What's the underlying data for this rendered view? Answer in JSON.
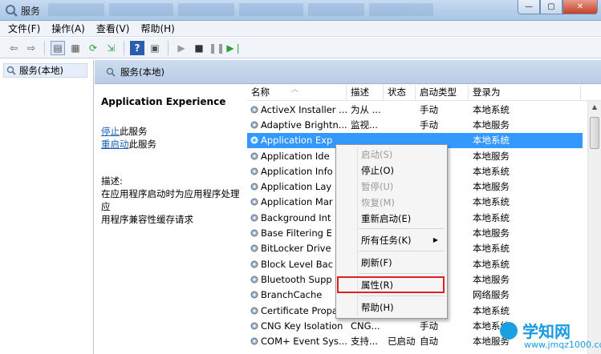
{
  "window": {
    "title": "服务",
    "buttons": {
      "minimize": "—",
      "maximize": "▢",
      "close": "✕"
    }
  },
  "menu": [
    "文件(F)",
    "操作(A)",
    "查看(V)",
    "帮助(H)"
  ],
  "tree": {
    "root": "服务(本地)"
  },
  "main": {
    "header": "服务(本地)",
    "detail": {
      "service_name": "Application Experience",
      "stop_link": "停止",
      "stop_rest": "此服务",
      "restart_link": "重启动",
      "restart_rest": "此服务",
      "desc_label": "描述:",
      "desc_line1": "在应用程序启动时为应用程序处理应",
      "desc_line2": "用程序兼容性缓存请求"
    },
    "columns": {
      "name": "名称",
      "desc": "描述",
      "status": "状态",
      "start": "启动类型",
      "logon": "登录为"
    },
    "rows": [
      {
        "name": "ActiveX Installer ...",
        "desc": "为从 ...",
        "status": "",
        "start": "手动",
        "logon": "本地系统"
      },
      {
        "name": "Adaptive Brightn...",
        "desc": "监视...",
        "status": "",
        "start": "手动",
        "logon": "本地服务"
      },
      {
        "name": "Application Exp",
        "desc": "",
        "status": "",
        "start": "",
        "logon": "本地系统"
      },
      {
        "name": "Application Ide",
        "desc": "",
        "status": "",
        "start": "",
        "logon": "本地服务"
      },
      {
        "name": "Application Info",
        "desc": "",
        "status": "",
        "start": "",
        "logon": "本地系统"
      },
      {
        "name": "Application Lay",
        "desc": "",
        "status": "",
        "start": "",
        "logon": "本地服务"
      },
      {
        "name": "Application Mar",
        "desc": "",
        "status": "",
        "start": "",
        "logon": "本地系统"
      },
      {
        "name": "Background Int",
        "desc": "",
        "status": "",
        "start": "",
        "logon": "本地系统"
      },
      {
        "name": "Base Filtering E",
        "desc": "",
        "status": "",
        "start": "",
        "logon": "本地服务"
      },
      {
        "name": "BitLocker Drive",
        "desc": "",
        "status": "",
        "start": "",
        "logon": "本地系统"
      },
      {
        "name": "Block Level Bac",
        "desc": "",
        "status": "",
        "start": "",
        "logon": "本地系统"
      },
      {
        "name": "Bluetooth Supp",
        "desc": "",
        "status": "",
        "start": "",
        "logon": "本地服务"
      },
      {
        "name": "BranchCache",
        "desc": "",
        "status": "",
        "start": "",
        "logon": "网络服务"
      },
      {
        "name": "Certificate Propa",
        "desc": "",
        "status": "",
        "start": "",
        "logon": "本地系统"
      },
      {
        "name": "CNG Key Isolation",
        "desc": "CNG...",
        "status": "",
        "start": "手动",
        "logon": "本地系统"
      },
      {
        "name": "COM+ Event Sys...",
        "desc": "支持...",
        "status": "已启动",
        "start": "自动",
        "logon": "本地服务"
      }
    ]
  },
  "context_menu": {
    "start": "启动(S)",
    "stop": "停止(O)",
    "pause": "暂停(U)",
    "resume": "恢复(M)",
    "restart": "重新启动(E)",
    "all_tasks": "所有任务(K)",
    "refresh": "刷新(F)",
    "properties": "属性(R)",
    "help": "帮助(H)"
  },
  "watermark": {
    "brand": "学知网",
    "url": "www.jmqz1000.com"
  },
  "colors": {
    "selection": "#3399ff",
    "link": "#1d5fb6",
    "highlight": "#e02020"
  }
}
